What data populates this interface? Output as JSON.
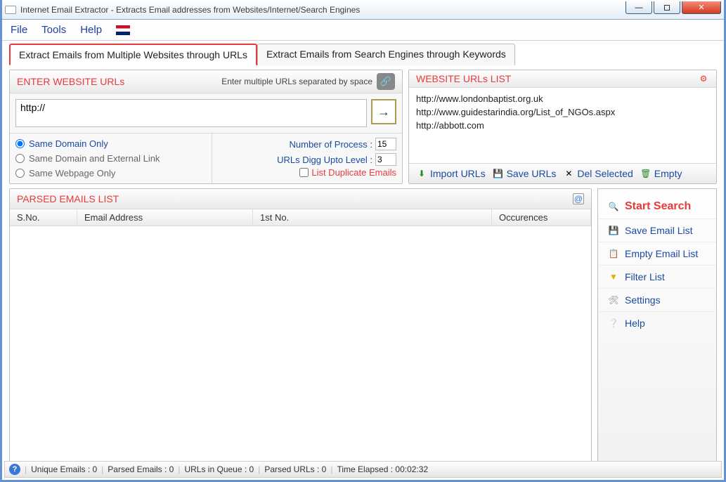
{
  "window": {
    "title": "Internet Email Extractor - Extracts Email addresses from Websites/Internet/Search Engines"
  },
  "menu": {
    "file": "File",
    "tools": "Tools",
    "help": "Help"
  },
  "tabs": {
    "t1": "Extract Emails from Multiple Websites through URLs",
    "t2": "Extract Emails from Search Engines through Keywords"
  },
  "left": {
    "title": "ENTER WEBSITE URLs",
    "hint": "Enter multiple URLs separated by space",
    "url_value": "http://",
    "radio1": "Same Domain Only",
    "radio2": "Same Domain and External Link",
    "radio3": "Same Webpage Only",
    "num_proc_label": "Number of Process :",
    "num_proc_value": "15",
    "digg_label": "URLs Digg Upto Level :",
    "digg_value": "3",
    "dup_label": "List Duplicate Emails"
  },
  "right": {
    "title": "WEBSITE URLs LIST",
    "urls": [
      "http://www.londonbaptist.org.uk",
      "http://www.guidestarindia.org/List_of_NGOs.aspx",
      "http://abbott.com"
    ],
    "act_import": "Import URLs",
    "act_save": "Save URLs",
    "act_del": "Del Selected",
    "act_empty": "Empty"
  },
  "parsed": {
    "title": "PARSED EMAILS LIST",
    "col_sno": "S.No.",
    "col_email": "Email Address",
    "col_1st": "1st No.",
    "col_occ": "Occurences"
  },
  "side": {
    "start": "Start Search",
    "save": "Save Email List",
    "empty": "Empty Email List",
    "filter": "Filter List",
    "settings": "Settings",
    "help": "Help"
  },
  "status": {
    "unique": "Unique Emails :  0",
    "parsed": "Parsed Emails :  0",
    "queue": "URLs in Queue :  0",
    "parsed_urls": "Parsed URLs :  0",
    "elapsed": "Time Elapsed :   00:02:32"
  }
}
